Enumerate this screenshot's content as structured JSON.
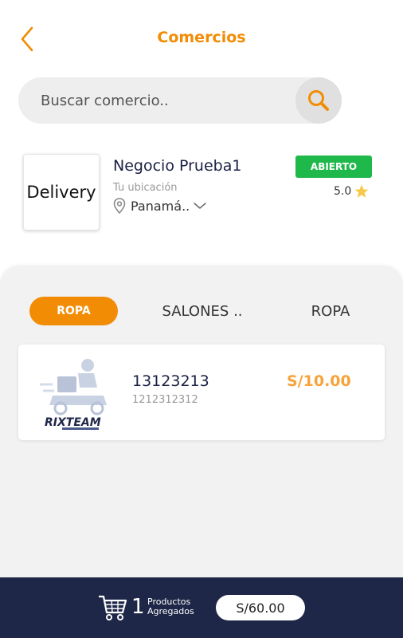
{
  "header": {
    "title": "Comercios"
  },
  "search": {
    "placeholder": "Buscar comercio.."
  },
  "store": {
    "logo_text": "Delivery",
    "name": "Negocio Prueba1",
    "location_label": "Tu ubicación",
    "location_value": "Panamá..",
    "status": "ABIERTO",
    "rating": "5.0"
  },
  "tabs": [
    {
      "label": "ROPA",
      "active": true
    },
    {
      "label": "SALONES ..",
      "active": false
    },
    {
      "label": "ROPA",
      "active": false
    }
  ],
  "products": [
    {
      "name": "13123213",
      "code": "1212312312",
      "price": "S/10.00",
      "image_text": "RIXTEAM"
    }
  ],
  "footer": {
    "cart_count": "1",
    "cart_label_line1": "Productos",
    "cart_label_line2": "Agregados",
    "total": "S/60.00"
  },
  "colors": {
    "accent": "#f28c05",
    "price": "#f7a33a",
    "open_badge": "#1fb84a",
    "footer_bg": "#1e2748",
    "star": "#f7c948"
  }
}
